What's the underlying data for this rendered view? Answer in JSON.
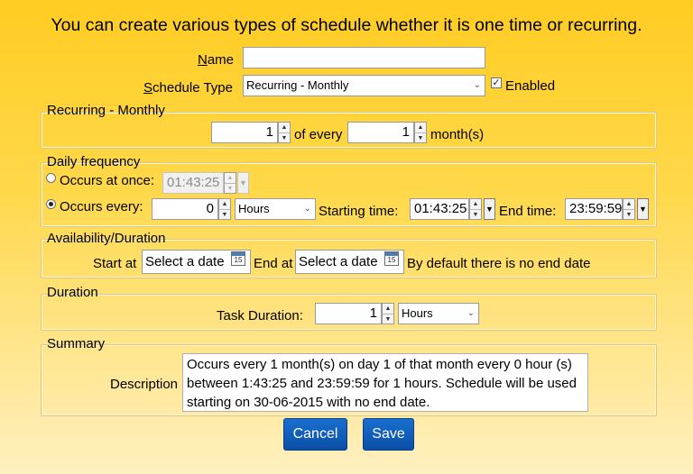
{
  "heading": "You can create various types of schedule whether it is one time or recurring.",
  "name": {
    "label": "Name",
    "value": ""
  },
  "schedule_type": {
    "label": "Schedule Type",
    "value": "Recurring - Monthly",
    "enabled_label": "Enabled",
    "enabled_checked": true
  },
  "recurring": {
    "legend": "Recurring - Monthly",
    "day_value": "1",
    "of_every_label": "of every",
    "months_value": "1",
    "months_suffix": "month(s)"
  },
  "daily": {
    "legend": "Daily frequency",
    "once_label": "Occurs at once:",
    "once_time": "01:43:25",
    "every_label": "Occurs every:",
    "every_value": "0",
    "unit": "Hours",
    "starting_label": "Starting time:",
    "starting_time": "01:43:25",
    "end_label": "End time:",
    "end_time": "23:59:59",
    "selected": "every"
  },
  "availability": {
    "legend": "Availability/Duration",
    "start_label": "Start at",
    "start_placeholder": "Select a date",
    "end_label": "End at",
    "end_placeholder": "Select a date",
    "calendar_day": "15",
    "note": "By default there is no end date"
  },
  "duration": {
    "legend": "Duration",
    "task_label": "Task Duration:",
    "value": "1",
    "unit": "Hours"
  },
  "summary": {
    "legend": "Summary",
    "description_label": "Description",
    "description": "Occurs every 1 month(s) on day 1 of that month every 0 hour (s) between 1:43:25 and 23:59:59 for 1 hours. Schedule will be used starting on 30-06-2015 with no end date."
  },
  "buttons": {
    "cancel": "Cancel",
    "save": "Save"
  },
  "colors": {
    "background_top": "#ffcc22",
    "background_bottom": "#fff0c0",
    "button": "#0a4fa6"
  }
}
